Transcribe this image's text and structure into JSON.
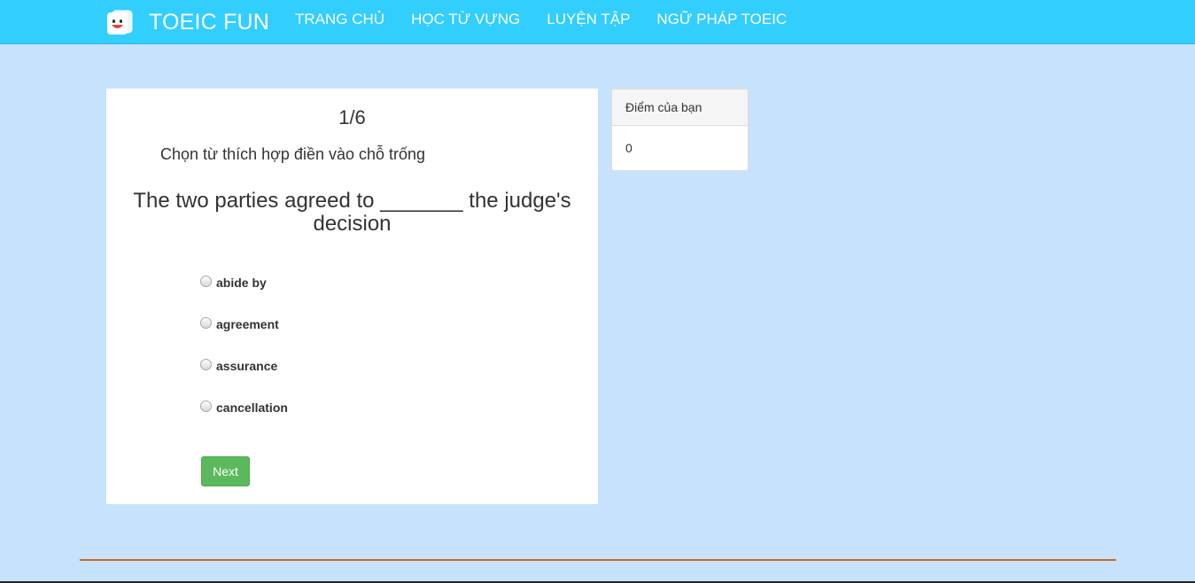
{
  "navbar": {
    "brand": "TOEIC FUN",
    "logo_icon": "smiley-card-icon",
    "items": [
      {
        "label": "TRANG CHỦ"
      },
      {
        "label": "HỌC TỪ VỰNG"
      },
      {
        "label": "LUYỆN TẬP"
      },
      {
        "label": "NGỮ PHÁP TOEIC"
      }
    ],
    "background_color": "#31cefe"
  },
  "quiz": {
    "progress": "1/6",
    "instruction": "Chọn từ thích hợp điền vào chỗ trống",
    "question": "The two parties agreed to _______ the judge's decision",
    "options": [
      {
        "label": "abide by",
        "selected": false
      },
      {
        "label": "agreement",
        "selected": false
      },
      {
        "label": "assurance",
        "selected": false
      },
      {
        "label": "cancellation",
        "selected": false
      }
    ],
    "next_label": "Next",
    "next_color": "#5cb85c"
  },
  "score": {
    "heading": "Điểm của bạn",
    "value": "0"
  },
  "page": {
    "background_color": "#c6e2fd",
    "footer_rule_color": "#d2691e"
  }
}
